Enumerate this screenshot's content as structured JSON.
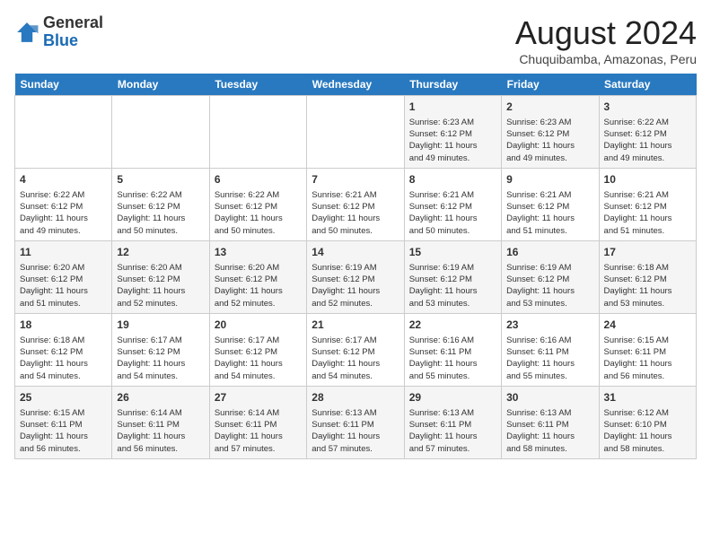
{
  "header": {
    "logo_general": "General",
    "logo_blue": "Blue",
    "month_title": "August 2024",
    "subtitle": "Chuquibamba, Amazonas, Peru"
  },
  "days_of_week": [
    "Sunday",
    "Monday",
    "Tuesday",
    "Wednesday",
    "Thursday",
    "Friday",
    "Saturday"
  ],
  "weeks": [
    [
      {
        "day": "",
        "detail": ""
      },
      {
        "day": "",
        "detail": ""
      },
      {
        "day": "",
        "detail": ""
      },
      {
        "day": "",
        "detail": ""
      },
      {
        "day": "1",
        "detail": "Sunrise: 6:23 AM\nSunset: 6:12 PM\nDaylight: 11 hours\nand 49 minutes."
      },
      {
        "day": "2",
        "detail": "Sunrise: 6:23 AM\nSunset: 6:12 PM\nDaylight: 11 hours\nand 49 minutes."
      },
      {
        "day": "3",
        "detail": "Sunrise: 6:22 AM\nSunset: 6:12 PM\nDaylight: 11 hours\nand 49 minutes."
      }
    ],
    [
      {
        "day": "4",
        "detail": "Sunrise: 6:22 AM\nSunset: 6:12 PM\nDaylight: 11 hours\nand 49 minutes."
      },
      {
        "day": "5",
        "detail": "Sunrise: 6:22 AM\nSunset: 6:12 PM\nDaylight: 11 hours\nand 50 minutes."
      },
      {
        "day": "6",
        "detail": "Sunrise: 6:22 AM\nSunset: 6:12 PM\nDaylight: 11 hours\nand 50 minutes."
      },
      {
        "day": "7",
        "detail": "Sunrise: 6:21 AM\nSunset: 6:12 PM\nDaylight: 11 hours\nand 50 minutes."
      },
      {
        "day": "8",
        "detail": "Sunrise: 6:21 AM\nSunset: 6:12 PM\nDaylight: 11 hours\nand 50 minutes."
      },
      {
        "day": "9",
        "detail": "Sunrise: 6:21 AM\nSunset: 6:12 PM\nDaylight: 11 hours\nand 51 minutes."
      },
      {
        "day": "10",
        "detail": "Sunrise: 6:21 AM\nSunset: 6:12 PM\nDaylight: 11 hours\nand 51 minutes."
      }
    ],
    [
      {
        "day": "11",
        "detail": "Sunrise: 6:20 AM\nSunset: 6:12 PM\nDaylight: 11 hours\nand 51 minutes."
      },
      {
        "day": "12",
        "detail": "Sunrise: 6:20 AM\nSunset: 6:12 PM\nDaylight: 11 hours\nand 52 minutes."
      },
      {
        "day": "13",
        "detail": "Sunrise: 6:20 AM\nSunset: 6:12 PM\nDaylight: 11 hours\nand 52 minutes."
      },
      {
        "day": "14",
        "detail": "Sunrise: 6:19 AM\nSunset: 6:12 PM\nDaylight: 11 hours\nand 52 minutes."
      },
      {
        "day": "15",
        "detail": "Sunrise: 6:19 AM\nSunset: 6:12 PM\nDaylight: 11 hours\nand 53 minutes."
      },
      {
        "day": "16",
        "detail": "Sunrise: 6:19 AM\nSunset: 6:12 PM\nDaylight: 11 hours\nand 53 minutes."
      },
      {
        "day": "17",
        "detail": "Sunrise: 6:18 AM\nSunset: 6:12 PM\nDaylight: 11 hours\nand 53 minutes."
      }
    ],
    [
      {
        "day": "18",
        "detail": "Sunrise: 6:18 AM\nSunset: 6:12 PM\nDaylight: 11 hours\nand 54 minutes."
      },
      {
        "day": "19",
        "detail": "Sunrise: 6:17 AM\nSunset: 6:12 PM\nDaylight: 11 hours\nand 54 minutes."
      },
      {
        "day": "20",
        "detail": "Sunrise: 6:17 AM\nSunset: 6:12 PM\nDaylight: 11 hours\nand 54 minutes."
      },
      {
        "day": "21",
        "detail": "Sunrise: 6:17 AM\nSunset: 6:12 PM\nDaylight: 11 hours\nand 54 minutes."
      },
      {
        "day": "22",
        "detail": "Sunrise: 6:16 AM\nSunset: 6:11 PM\nDaylight: 11 hours\nand 55 minutes."
      },
      {
        "day": "23",
        "detail": "Sunrise: 6:16 AM\nSunset: 6:11 PM\nDaylight: 11 hours\nand 55 minutes."
      },
      {
        "day": "24",
        "detail": "Sunrise: 6:15 AM\nSunset: 6:11 PM\nDaylight: 11 hours\nand 56 minutes."
      }
    ],
    [
      {
        "day": "25",
        "detail": "Sunrise: 6:15 AM\nSunset: 6:11 PM\nDaylight: 11 hours\nand 56 minutes."
      },
      {
        "day": "26",
        "detail": "Sunrise: 6:14 AM\nSunset: 6:11 PM\nDaylight: 11 hours\nand 56 minutes."
      },
      {
        "day": "27",
        "detail": "Sunrise: 6:14 AM\nSunset: 6:11 PM\nDaylight: 11 hours\nand 57 minutes."
      },
      {
        "day": "28",
        "detail": "Sunrise: 6:13 AM\nSunset: 6:11 PM\nDaylight: 11 hours\nand 57 minutes."
      },
      {
        "day": "29",
        "detail": "Sunrise: 6:13 AM\nSunset: 6:11 PM\nDaylight: 11 hours\nand 57 minutes."
      },
      {
        "day": "30",
        "detail": "Sunrise: 6:13 AM\nSunset: 6:11 PM\nDaylight: 11 hours\nand 58 minutes."
      },
      {
        "day": "31",
        "detail": "Sunrise: 6:12 AM\nSunset: 6:10 PM\nDaylight: 11 hours\nand 58 minutes."
      }
    ]
  ]
}
